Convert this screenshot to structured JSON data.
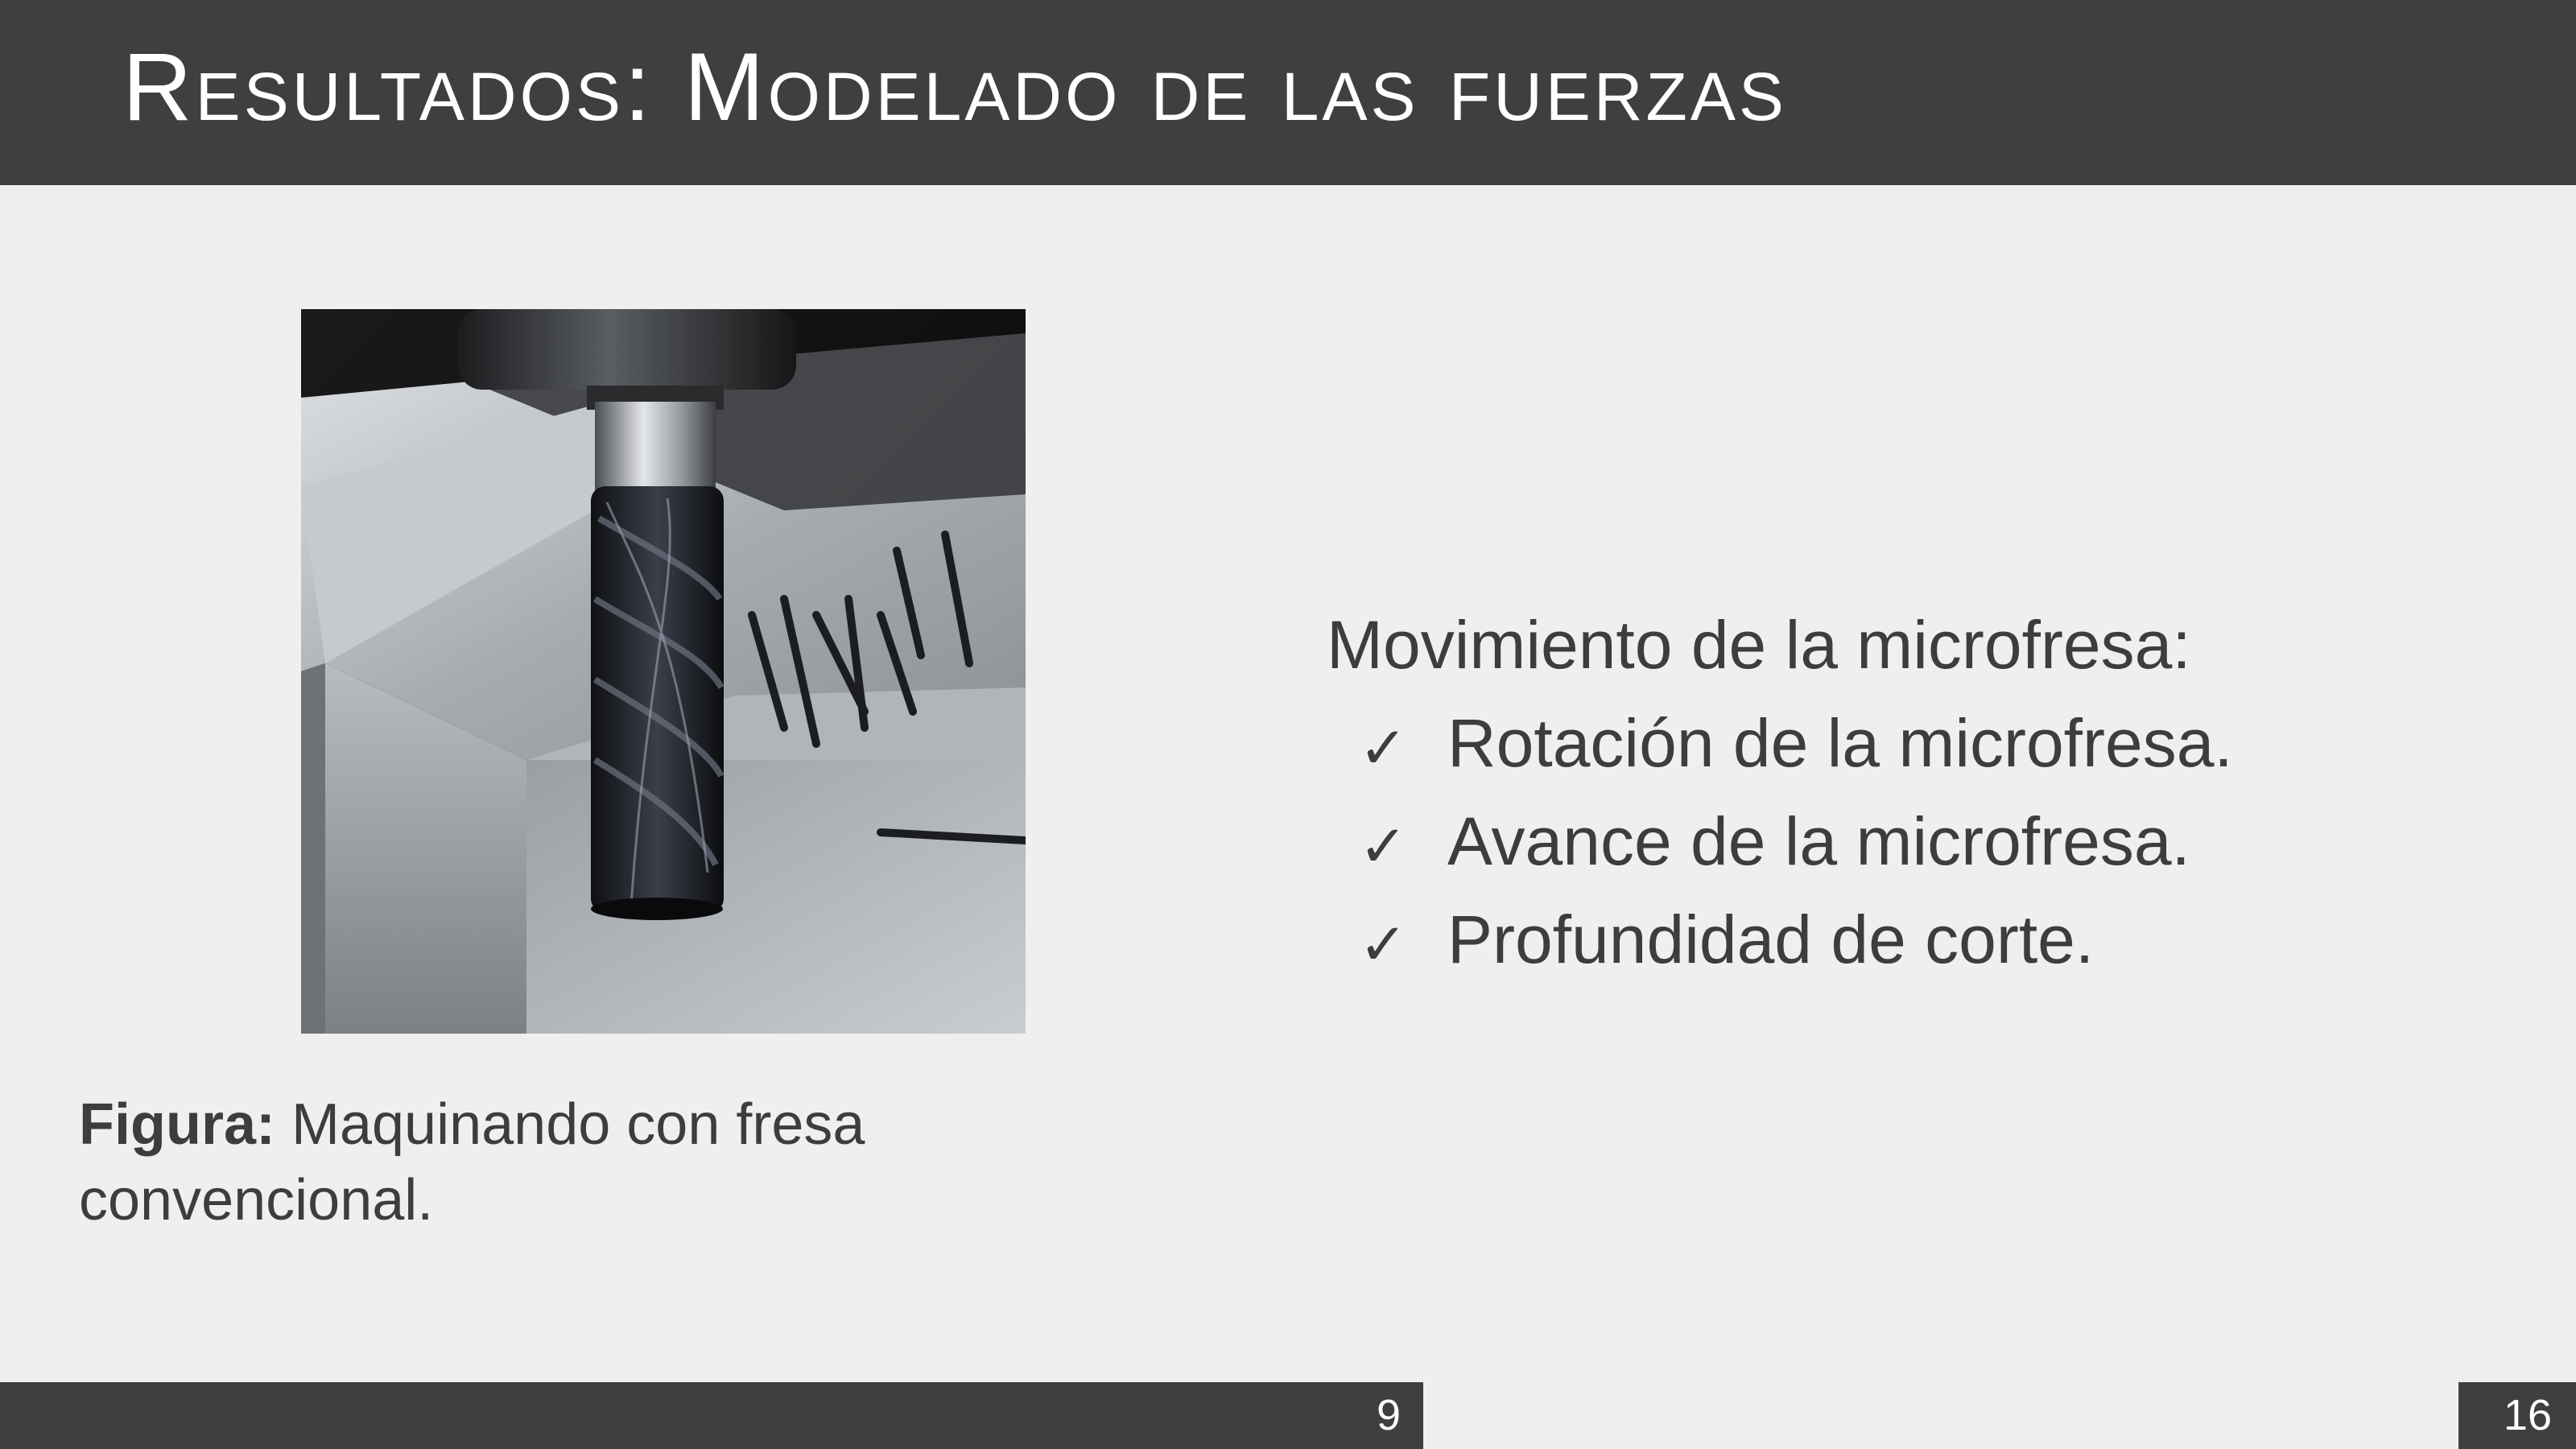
{
  "header": {
    "title": "Resultados: Modelado de las fuerzas"
  },
  "figure": {
    "image_desc_icon": "end-mill-machining-image",
    "caption_label": "Figura:",
    "caption_text": " Maquinando con fresa convencional."
  },
  "content": {
    "intro": "Movimiento de la microfresa:",
    "items": [
      "Rotación de la microfresa.",
      "Avance de la microfresa.",
      "Profundidad de corte."
    ],
    "check_glyph": "✓"
  },
  "footer": {
    "current_page": "9",
    "total_pages": "16"
  },
  "colors": {
    "bar": "#3f3f3f",
    "background": "#efefef",
    "text": "#3d3d3d"
  }
}
